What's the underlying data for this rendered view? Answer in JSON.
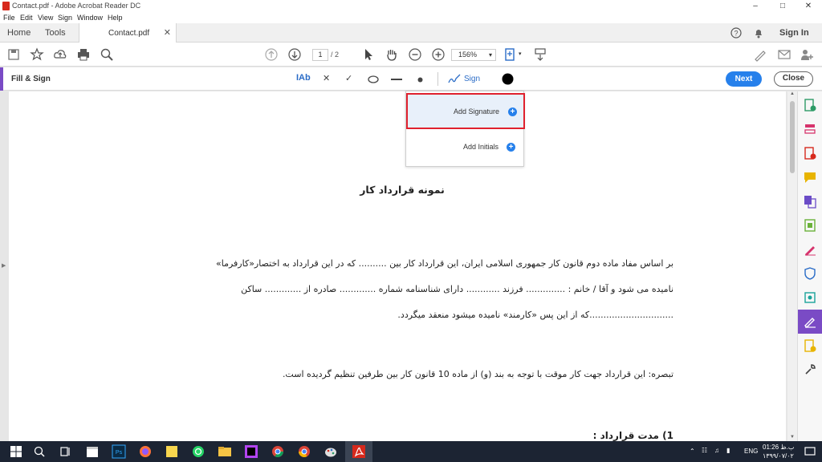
{
  "window": {
    "title": "Contact.pdf - Adobe Acrobat Reader DC"
  },
  "menu": [
    "File",
    "Edit",
    "View",
    "Sign",
    "Window",
    "Help"
  ],
  "tabs": {
    "home": "Home",
    "tools": "Tools",
    "document": "Contact.pdf"
  },
  "header_right": {
    "sign_in": "Sign In"
  },
  "toolbar": {
    "page_current": "1",
    "page_total": "/ 2",
    "zoom": "156%"
  },
  "fillsign": {
    "label": "Fill & Sign",
    "text_tool": "IAb",
    "sign_label": "Sign",
    "next": "Next",
    "close": "Close"
  },
  "signature_menu": {
    "add_signature": "Add Signature",
    "add_initials": "Add Initials"
  },
  "document": {
    "heading": "نمونه قرارداد کار",
    "p1_l1": "بر اساس مفاد ماده دوم قانون کار جمهوری اسلامی ایران، این قرارداد کار بین .......... که در این قرارداد به اختصار«کارفرما»",
    "p1_l2": "نامیده می شود و آقا / خانم : .............. فرزند ............ دارای شناسنامه شماره ............. صادره از ............. ساکن",
    "p1_l3": "..............................که از این پس «کارمند» نامیده میشود منعقد میگردد.",
    "note": "تبصره: این قرارداد جهت کار موقت با توجه به بند (و) از ماده 10 قانون کار بین طرفین تنظیم گردیده است.",
    "section1": "1) مدت قرارداد :"
  },
  "taskbar": {
    "lang": "ENG",
    "time": "01:26 ب.ظ",
    "date": "۱۳۹۹/۰۷/۰۲"
  }
}
